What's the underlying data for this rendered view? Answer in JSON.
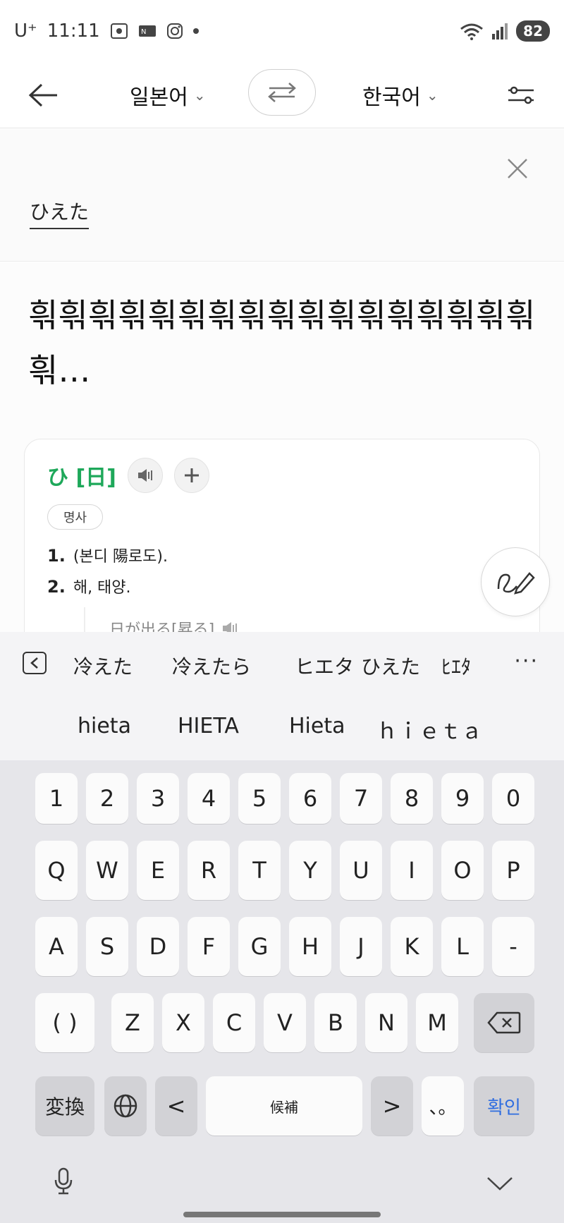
{
  "status_bar": {
    "carrier": "U⁺",
    "time": "11:11",
    "battery": "82"
  },
  "top_bar": {
    "source_lang": "일본어",
    "target_lang": "한국어"
  },
  "input": {
    "text": "ひえた"
  },
  "result": {
    "text": "흮흮흮흮흮흮흮흮흮흮흮흮흮흮흮흮흮흮…"
  },
  "dictionary": {
    "headword": "ひ [日]",
    "part_of_speech": "명사",
    "definitions": [
      {
        "num": "1.",
        "text": "(본디 陽로도)."
      },
      {
        "num": "2.",
        "text": "해, 태양."
      }
    ],
    "example": "日が出る[昇る]"
  },
  "suggestions": {
    "row1": [
      "冷えた",
      "冷えたら",
      "ヒエタ",
      "ひえた",
      "ﾋｴﾀ"
    ],
    "more": "···",
    "row2": [
      "hieta",
      "HIETA",
      "Hieta",
      "ｈｉｅｔａ"
    ]
  },
  "keyboard": {
    "numbers": [
      "1",
      "2",
      "3",
      "4",
      "5",
      "6",
      "7",
      "8",
      "9",
      "0"
    ],
    "row_q": [
      "Q",
      "W",
      "E",
      "R",
      "T",
      "Y",
      "U",
      "I",
      "O",
      "P"
    ],
    "row_a": [
      "A",
      "S",
      "D",
      "F",
      "G",
      "H",
      "J",
      "K",
      "L",
      "-"
    ],
    "row_z_first": "( )",
    "row_z": [
      "Z",
      "X",
      "C",
      "V",
      "B",
      "N",
      "M"
    ],
    "convert": "変換",
    "left": "<",
    "space": "候補",
    "right": ">",
    "punct": "、。",
    "confirm": "확인"
  },
  "colors": {
    "accent_green": "#1ea85a",
    "confirm_blue": "#2f6de0"
  }
}
